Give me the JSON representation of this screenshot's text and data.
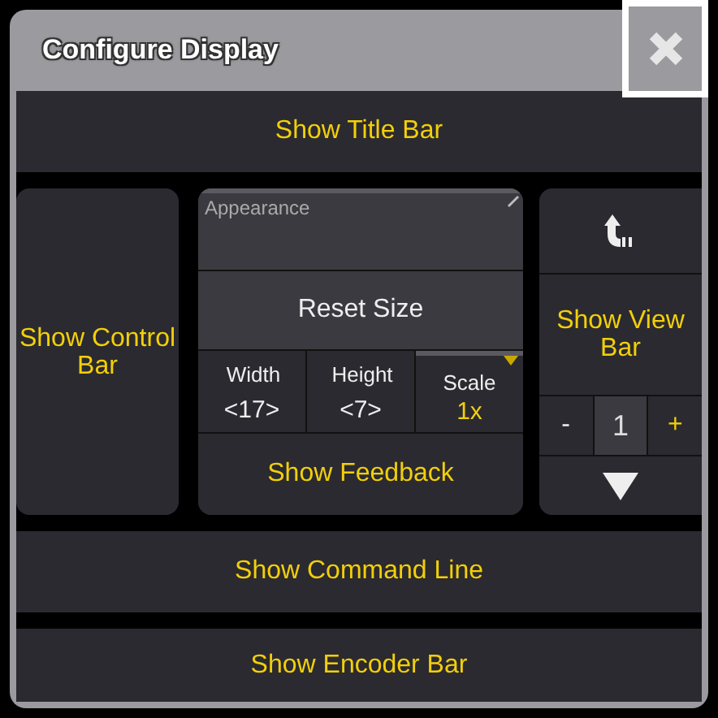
{
  "window": {
    "title": "Configure Display"
  },
  "title_bar_button": {
    "label": "Show Title Bar"
  },
  "control_bar_button": {
    "label": "Show Control Bar"
  },
  "appearance": {
    "label": "Appearance",
    "reset_button": "Reset Size",
    "fields": [
      {
        "kind": "stepper",
        "label": "Width",
        "value": "<17>"
      },
      {
        "kind": "stepper",
        "label": "Height",
        "value": "<7>"
      },
      {
        "kind": "dropdown",
        "label": "Scale",
        "value": "1x"
      }
    ],
    "feedback_button": "Show Feedback"
  },
  "view_bar": {
    "label": "Show View Bar",
    "minus": "-",
    "count": "1",
    "plus": "+"
  },
  "bottom_buttons": [
    {
      "label": "Show Command Line"
    },
    {
      "label": "Show Encoder Bar"
    }
  ]
}
